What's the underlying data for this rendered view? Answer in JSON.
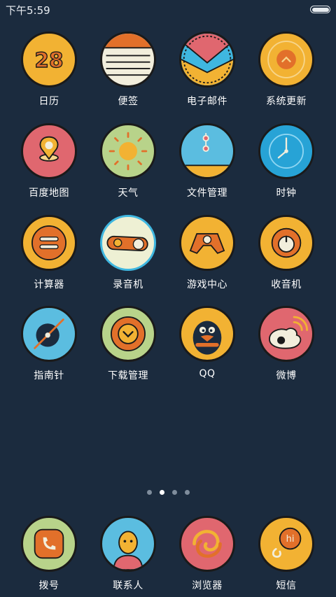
{
  "status_bar": {
    "time": "下午5:59"
  },
  "pages": {
    "count": 4,
    "active_index": 1
  },
  "apps": [
    {
      "label": "日历",
      "icon": "calendar-icon",
      "color": "#f2b233",
      "text": "28"
    },
    {
      "label": "便签",
      "icon": "notes-icon",
      "color": "#f2eedc"
    },
    {
      "label": "电子邮件",
      "icon": "email-icon",
      "color": "#3fb7e0"
    },
    {
      "label": "系统更新",
      "icon": "system-update-icon",
      "color": "#f2b233"
    },
    {
      "label": "百度地图",
      "icon": "map-pin-icon",
      "color": "#e0676f"
    },
    {
      "label": "天气",
      "icon": "sun-icon",
      "color": "#b8d38a"
    },
    {
      "label": "文件管理",
      "icon": "file-manager-icon",
      "color": "#5bbde0"
    },
    {
      "label": "时钟",
      "icon": "clock-icon",
      "color": "#27a3d6"
    },
    {
      "label": "计算器",
      "icon": "calculator-icon",
      "color": "#f2b233"
    },
    {
      "label": "录音机",
      "icon": "recorder-icon",
      "color": "#eef0d4"
    },
    {
      "label": "游戏中心",
      "icon": "gamepad-icon",
      "color": "#f2b233"
    },
    {
      "label": "收音机",
      "icon": "radio-knob-icon",
      "color": "#f2b233"
    },
    {
      "label": "指南针",
      "icon": "compass-icon",
      "color": "#5bbde0"
    },
    {
      "label": "下载管理",
      "icon": "download-icon",
      "color": "#b8d38a"
    },
    {
      "label": "QQ",
      "icon": "qq-penguin-icon",
      "color": "#f2b233"
    },
    {
      "label": "微博",
      "icon": "weibo-icon",
      "color": "#e0676f"
    }
  ],
  "dock": [
    {
      "label": "拨号",
      "icon": "phone-icon",
      "color": "#b8d38a"
    },
    {
      "label": "联系人",
      "icon": "contact-person-icon",
      "color": "#5bbde0"
    },
    {
      "label": "浏览器",
      "icon": "browser-swirl-icon",
      "color": "#e0676f"
    },
    {
      "label": "短信",
      "icon": "message-bubble-icon",
      "color": "#f2b233",
      "text": "hi"
    }
  ]
}
